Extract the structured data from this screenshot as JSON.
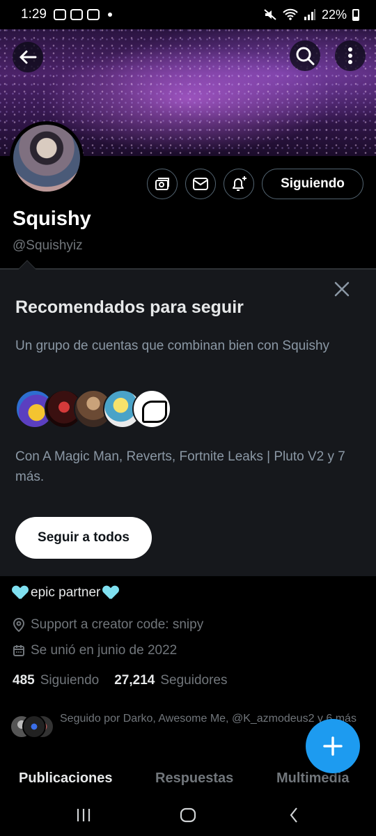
{
  "status_bar": {
    "time": "1:29",
    "battery": "22%"
  },
  "profile": {
    "display_name": "Squishy",
    "handle": "@Squishyiz",
    "following_button": "Siguiendo",
    "bio": "epic partner",
    "location": "Support a creator code: snipy",
    "joined": "Se unió en junio de 2022",
    "following_count": "485",
    "following_label": "Siguiendo",
    "followers_count": "27,214",
    "followers_label": "Seguidores",
    "followed_by": "Seguido por Darko, Awesome Me, @K_azmodeus2 y 6 más"
  },
  "recommendations": {
    "title": "Recomendados para seguir",
    "description": "Un grupo de cuentas que combinan bien con Squishy",
    "names": "Con A Magic Man, Reverts, Fortnite Leaks | Pluto V2 y 7 más.",
    "follow_all_button": "Seguir a todos"
  },
  "tabs": [
    {
      "label": "Publicaciones",
      "active": true
    },
    {
      "label": "Respuestas",
      "active": false
    },
    {
      "label": "Multimedia",
      "active": false
    }
  ],
  "colors": {
    "accent": "#1d9bf0",
    "muted": "#71767b",
    "card_bg": "#16181c"
  },
  "icons": [
    "back-arrow-icon",
    "search-icon",
    "more-vertical-icon",
    "subscription-icon",
    "mail-icon",
    "bell-plus-icon",
    "close-icon",
    "location-pin-icon",
    "calendar-icon",
    "plus-icon"
  ]
}
